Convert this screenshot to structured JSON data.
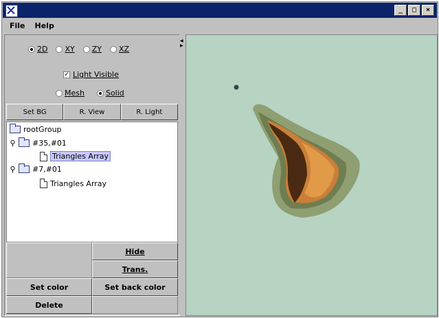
{
  "window": {
    "title": "",
    "controls": [
      "_",
      "□",
      "×"
    ]
  },
  "menu": {
    "items": [
      "File",
      "Help"
    ]
  },
  "projection": {
    "options": [
      "2D",
      "XY",
      "ZY",
      "XZ"
    ],
    "selected": "2D"
  },
  "light": {
    "label": "Light Visible",
    "checked": true
  },
  "render_mode": {
    "options": [
      "Mesh",
      "Solid"
    ],
    "selected": "Solid"
  },
  "toolbar": {
    "set_bg": "Set BG",
    "reset_view": "R. View",
    "reset_light": "R. Light"
  },
  "tree": {
    "root": "rootGroup",
    "group1": "#35,#01",
    "group1_child": "Triangles Array",
    "group2": "#7,#01",
    "group2_child": "Triangles Array"
  },
  "actions": {
    "hide": "Hide",
    "trans": "Trans.",
    "set_color": "Set color",
    "set_back_color": "Set back color",
    "delete": "Delete"
  },
  "viewport": {
    "background_color": "#b7d3c2",
    "shape": "3d-surface-mesh"
  },
  "colors": {
    "title_bar": "#0a246a",
    "panel": "#c0c0c0",
    "selection": "#c8c8ff"
  }
}
